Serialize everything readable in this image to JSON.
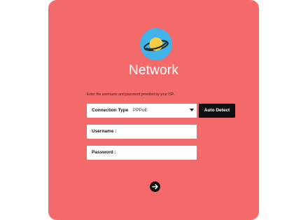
{
  "app": {
    "title": "Network",
    "logo_icon": "planet-icon"
  },
  "form": {
    "hint": "Enter the username and password provided by your ISP.",
    "connection_type": {
      "label": "Connection Type",
      "value": "PPPoE",
      "options": [
        "PPPoE"
      ]
    },
    "auto_detect_label": "Auto Detect",
    "username": {
      "label": "Username :",
      "value": ""
    },
    "password": {
      "label": "Password :",
      "value": ""
    },
    "next_icon": "arrow-right-icon"
  },
  "colors": {
    "card_background": "#f46a6a",
    "logo_background": "#3fb3ea",
    "planet": "#f7cc42",
    "button": "#111111"
  }
}
